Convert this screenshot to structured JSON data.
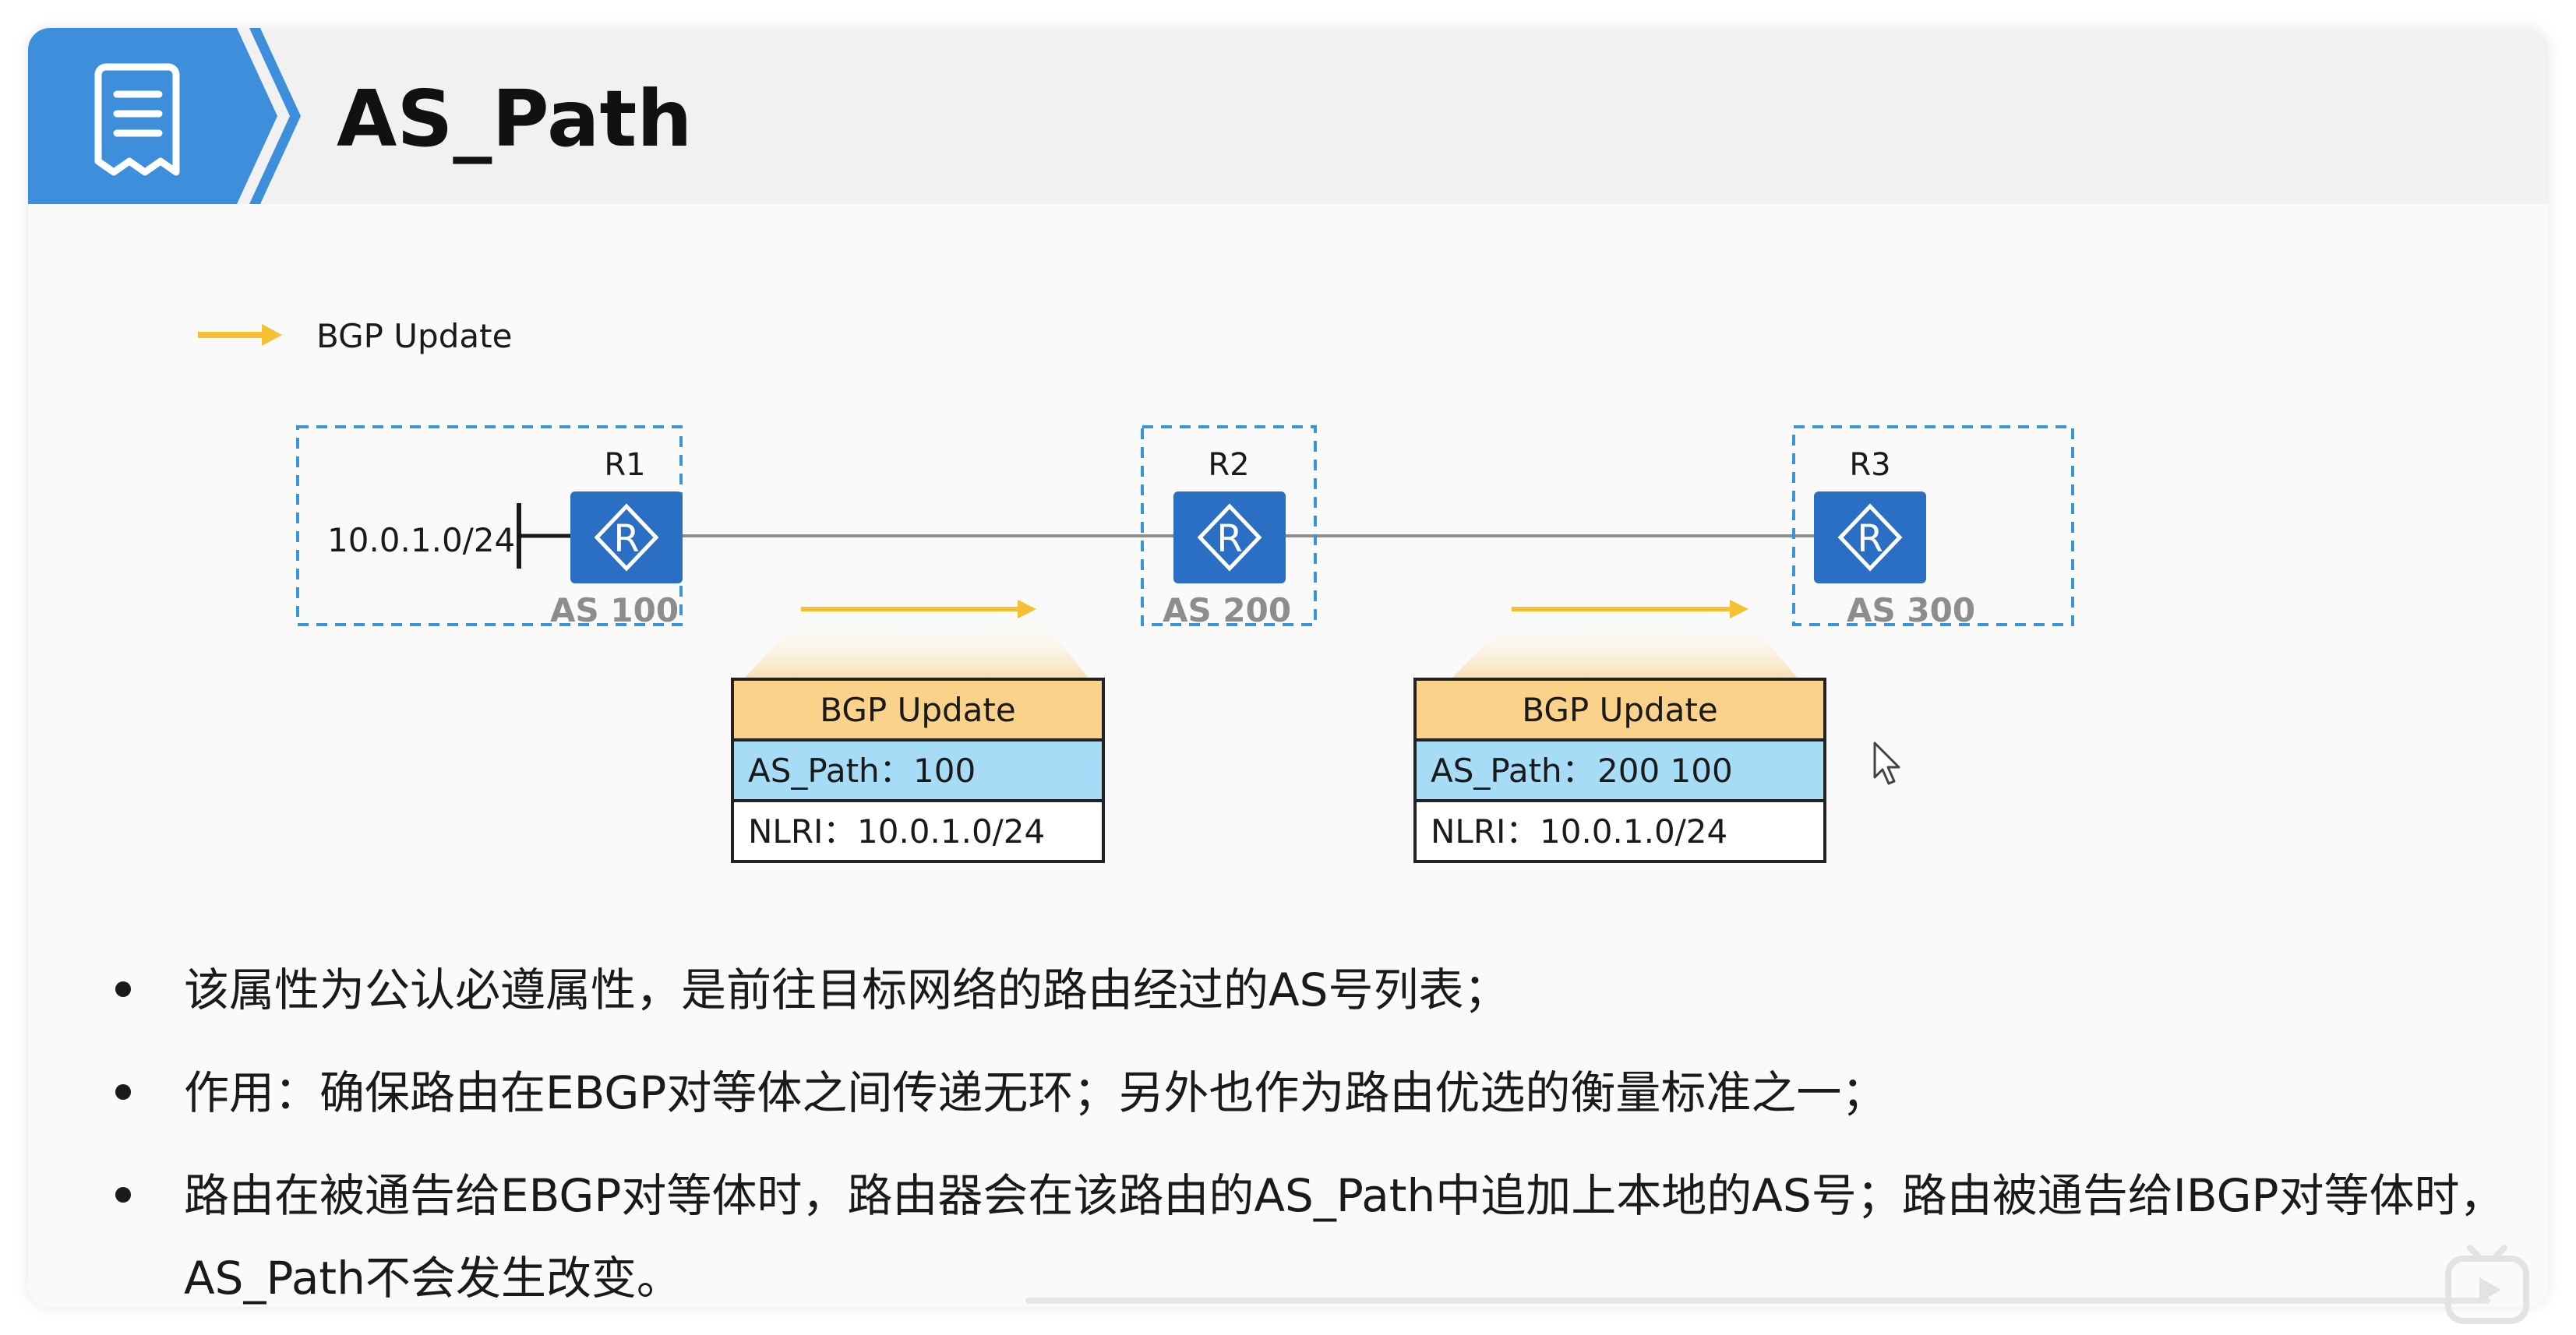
{
  "title": "AS_Path",
  "legend": {
    "label": "BGP Update",
    "arrow_color": "#f7c032"
  },
  "routers": [
    {
      "name": "R1",
      "as": "AS 100",
      "network": "10.0.1.0/24"
    },
    {
      "name": "R2",
      "as": "AS 200"
    },
    {
      "name": "R3",
      "as": "AS 300"
    }
  ],
  "router_icon_letter": "R",
  "updates": [
    {
      "header": "BGP Update",
      "as_path_label": "AS_Path：",
      "as_path_value": "100",
      "nlri_label": "NLRI：",
      "nlri_value": "10.0.1.0/24"
    },
    {
      "header": "BGP Update",
      "as_path_label": "AS_Path：",
      "as_path_value": "200 100",
      "nlri_label": "NLRI：",
      "nlri_value": "10.0.1.0/24"
    }
  ],
  "bullets": [
    "该属性为公认必遵属性，是前往目标网络的路由经过的AS号列表；",
    "作用：确保路由在EBGP对等体之间传递无环；另外也作为路由优选的衡量标准之一；",
    "路由在被通告给EBGP对等体时，路由器会在该路由的AS_Path中追加上本地的AS号；路由被通告给IBGP对等体时，AS_Path不会发生改变。"
  ],
  "colors": {
    "brand_blue": "#3d8fdc",
    "router_blue": "#2a6fc4",
    "update_header": "#fbd28a",
    "as_path_row": "#a6dcf5",
    "dashed_border": "#3a95d8"
  },
  "icons": {
    "header": "document-icon",
    "router": "router-icon",
    "cursor": "mouse-pointer-icon",
    "corner": "video-logo-icon"
  }
}
